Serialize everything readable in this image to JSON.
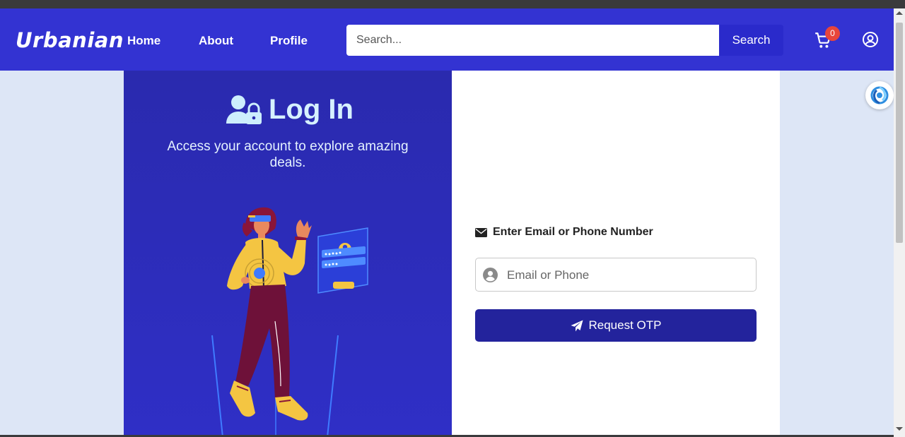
{
  "navbar": {
    "brand": "Urbanian",
    "links": [
      {
        "label": "Home"
      },
      {
        "label": "About"
      },
      {
        "label": "Profile"
      }
    ],
    "search": {
      "placeholder": "Search...",
      "button_label": "Search"
    },
    "cart_count": "0",
    "icons": [
      "cart-icon",
      "user-circle-icon"
    ],
    "color": "#3333d2"
  },
  "login": {
    "title": "Log In",
    "title_icon": "user-lock-icon",
    "subtitle": "Access your account to explore amazing deals.",
    "field_label": "Enter Email or Phone Number",
    "field_icon": "envelope-icon",
    "input_placeholder": "Email or Phone",
    "input_icon": "person-circle-icon",
    "button_label": "Request OTP",
    "button_icon": "paper-plane-icon",
    "panel_color": "#2a2aae",
    "button_color": "#23239c"
  },
  "floating_button": {
    "icon": "spiral-icon"
  }
}
